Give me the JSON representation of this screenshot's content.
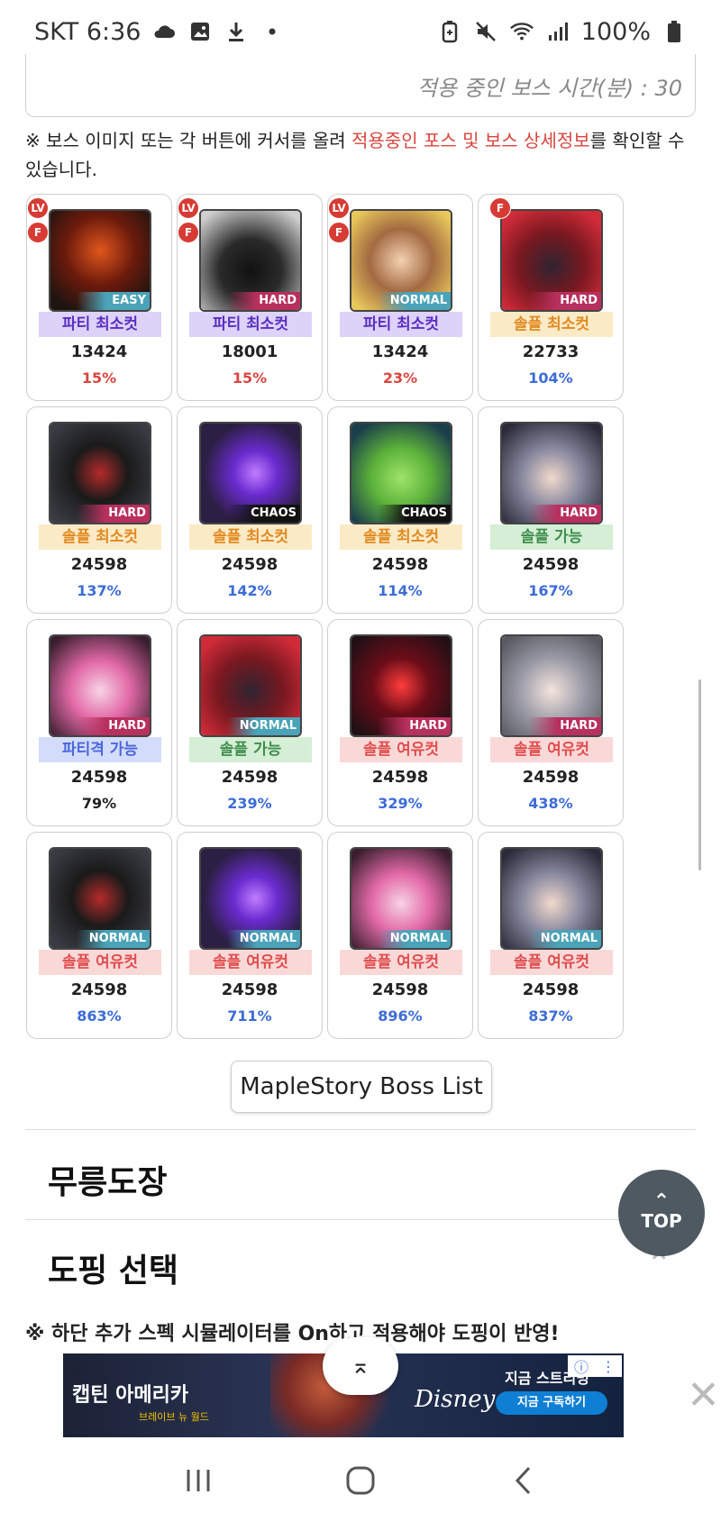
{
  "status_bar": {
    "carrier_time": "SKT 6:36",
    "battery": "100%",
    "icons_left": [
      "cloud-icon",
      "image-icon",
      "download-icon",
      "dot-icon"
    ],
    "icons_right": [
      "battery-saver-icon",
      "mute-icon",
      "wifi-icon",
      "signal-icon",
      "battery-icon"
    ]
  },
  "top_card": {
    "boss_time_text": "적용 중인 보스 시간(분) : 30"
  },
  "notice": {
    "prefix": "※ 보스 이미지 또는 각 버튼에 커서를 올려 ",
    "highlight": "적용중인 포스 및 보스 상세정보",
    "suffix": "를 확인할 수 있습니다."
  },
  "bosses": [
    {
      "difficulty": "EASY",
      "diff_class": "easy",
      "art": "fire",
      "badges": [
        "LV",
        "F"
      ],
      "status": "파티 최소컷",
      "status_class": "party",
      "power": "13424",
      "percent": "15%",
      "pct_color": "red"
    },
    {
      "difficulty": "HARD",
      "diff_class": "hard",
      "art": "hood",
      "badges": [
        "LV",
        "F"
      ],
      "status": "파티 최소컷",
      "status_class": "party",
      "power": "18001",
      "percent": "15%",
      "pct_color": "red"
    },
    {
      "difficulty": "NORMAL",
      "diff_class": "normal",
      "art": "girl",
      "badges": [
        "LV",
        "F"
      ],
      "status": "파티 최소컷",
      "status_class": "party",
      "power": "13424",
      "percent": "23%",
      "pct_color": "red"
    },
    {
      "difficulty": "HARD",
      "diff_class": "hard",
      "art": "red",
      "badges": [
        "F"
      ],
      "status": "솔플 최소컷",
      "status_class": "solo-min",
      "power": "22733",
      "percent": "104%",
      "pct_color": "blue"
    },
    {
      "difficulty": "HARD",
      "diff_class": "hard",
      "art": "armor",
      "badges": [],
      "status": "솔플 최소컷",
      "status_class": "solo-min",
      "power": "24598",
      "percent": "137%",
      "pct_color": "blue"
    },
    {
      "difficulty": "CHAOS",
      "diff_class": "chaos",
      "art": "orb",
      "badges": [],
      "status": "솔플 최소컷",
      "status_class": "solo-min",
      "power": "24598",
      "percent": "142%",
      "pct_color": "blue"
    },
    {
      "difficulty": "CHAOS",
      "diff_class": "chaos",
      "art": "slime",
      "badges": [],
      "status": "솔플 최소컷",
      "status_class": "solo-min",
      "power": "24598",
      "percent": "114%",
      "pct_color": "blue"
    },
    {
      "difficulty": "HARD",
      "diff_class": "hard",
      "art": "glasses",
      "badges": [],
      "status": "솔플 가능",
      "status_class": "solo-ok",
      "power": "24598",
      "percent": "167%",
      "pct_color": "blue"
    },
    {
      "difficulty": "HARD",
      "diff_class": "hard",
      "art": "pink",
      "badges": [],
      "status": "파티격 가능",
      "status_class": "party-ok",
      "power": "24598",
      "percent": "79%",
      "pct_color": "black"
    },
    {
      "difficulty": "NORMAL",
      "diff_class": "normal",
      "art": "red",
      "badges": [],
      "status": "솔플 가능",
      "status_class": "solo-ok",
      "power": "24598",
      "percent": "239%",
      "pct_color": "blue"
    },
    {
      "difficulty": "HARD",
      "diff_class": "hard",
      "art": "crimson",
      "badges": [],
      "status": "솔플 여유컷",
      "status_class": "solo-easy",
      "power": "24598",
      "percent": "329%",
      "pct_color": "blue"
    },
    {
      "difficulty": "HARD",
      "diff_class": "hard",
      "art": "silver",
      "badges": [],
      "status": "솔플 여유컷",
      "status_class": "solo-easy",
      "power": "24598",
      "percent": "438%",
      "pct_color": "blue"
    },
    {
      "difficulty": "NORMAL",
      "diff_class": "normal",
      "art": "armor",
      "badges": [],
      "status": "솔플 여유컷",
      "status_class": "solo-easy",
      "power": "24598",
      "percent": "863%",
      "pct_color": "blue"
    },
    {
      "difficulty": "NORMAL",
      "diff_class": "normal",
      "art": "orb",
      "badges": [],
      "status": "솔플 여유컷",
      "status_class": "solo-easy",
      "power": "24598",
      "percent": "711%",
      "pct_color": "blue"
    },
    {
      "difficulty": "NORMAL",
      "diff_class": "normal",
      "art": "pink",
      "badges": [],
      "status": "솔플 여유컷",
      "status_class": "solo-easy",
      "power": "24598",
      "percent": "896%",
      "pct_color": "blue"
    },
    {
      "difficulty": "NORMAL",
      "diff_class": "normal",
      "art": "glasses",
      "badges": [],
      "status": "솔플 여유컷",
      "status_class": "solo-easy",
      "power": "24598",
      "percent": "837%",
      "pct_color": "blue"
    }
  ],
  "boss_list_button": "MapleStory Boss List",
  "sections": {
    "mureung": "무릉도장",
    "doping": "도핑 선택"
  },
  "top_button": "TOP",
  "doping_notice": "※ 하단 추가 스펙 시뮬레이터를 On하고 적용해야 도핑이 반영!",
  "ad": {
    "title": "캡틴 아메리카",
    "subtitle": "브레이브 뉴 월드",
    "brand": "Disney+",
    "cta_top": "지금 스트리밍",
    "cta_button": "지금 구독하기"
  },
  "colors": {
    "red_badge": "#d63b34",
    "highlight_red": "#d9463f",
    "percent_blue": "#3d6cd6",
    "top_button_bg": "#4f5961"
  }
}
